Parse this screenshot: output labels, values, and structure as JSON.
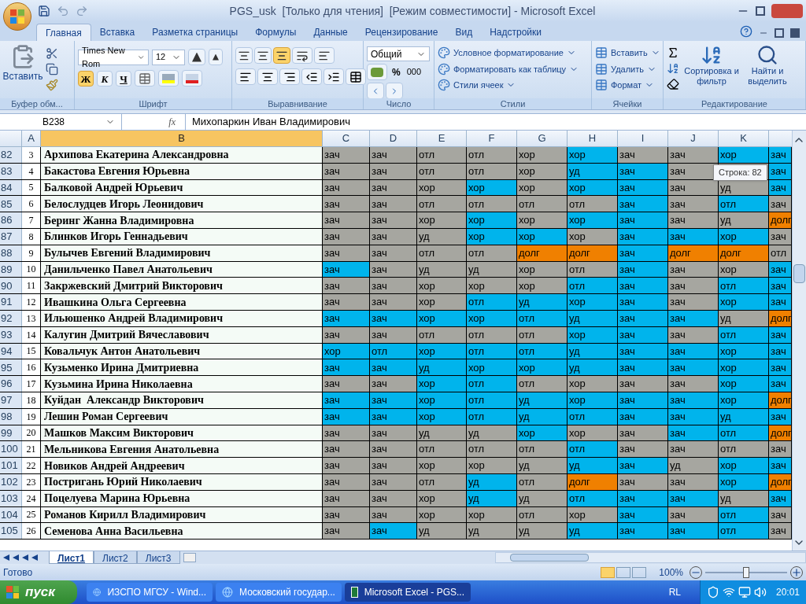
{
  "window": {
    "title": "PGS_usk  [Только для чтения]  [Режим совместимости] - Microsoft Excel"
  },
  "ribbon_tabs": [
    {
      "label": "Главная",
      "selected": true
    },
    {
      "label": "Вставка",
      "selected": false
    },
    {
      "label": "Разметка страницы",
      "selected": false
    },
    {
      "label": "Формулы",
      "selected": false
    },
    {
      "label": "Данные",
      "selected": false
    },
    {
      "label": "Рецензирование",
      "selected": false
    },
    {
      "label": "Вид",
      "selected": false
    },
    {
      "label": "Надстройки",
      "selected": false
    }
  ],
  "ribbon": {
    "clipboard": {
      "label": "Буфер обм...",
      "paste": "Вставить"
    },
    "font": {
      "label": "Шрифт",
      "font_name": "Times New Rom",
      "font_size": "12",
      "styles": [
        {
          "text": "Ж",
          "selected": true
        },
        {
          "text": "К",
          "selected": false
        },
        {
          "text": "Ч",
          "selected": false
        }
      ]
    },
    "alignment": {
      "label": "Выравнивание",
      "vertical": [
        {
          "selected": false
        },
        {
          "selected": false
        },
        {
          "selected": true
        }
      ]
    },
    "number": {
      "label": "Число",
      "format": "Общий",
      "percent": "%",
      "thousands": "000"
    },
    "styles": {
      "label": "Стили",
      "items": [
        "Условное форматирование",
        "Форматировать как таблицу",
        "Стили ячеек"
      ]
    },
    "cells": {
      "label": "Ячейки",
      "items": [
        "Вставить",
        "Удалить",
        "Формат"
      ]
    },
    "editing": {
      "label": "Редактирование",
      "sort": "Сортировка и фильтр",
      "find": "Найти и выделить"
    }
  },
  "formula_bar": {
    "name_box": "B238",
    "fx": "fx",
    "value": "Михопаркин Иван Владимирович"
  },
  "columns": [
    {
      "label": "A",
      "selected": false
    },
    {
      "label": "B",
      "selected": true
    },
    {
      "label": "C",
      "selected": false
    },
    {
      "label": "D",
      "selected": false
    },
    {
      "label": "E",
      "selected": false
    },
    {
      "label": "F",
      "selected": false
    },
    {
      "label": "G",
      "selected": false
    },
    {
      "label": "H",
      "selected": false
    },
    {
      "label": "I",
      "selected": false
    },
    {
      "label": "J",
      "selected": false
    },
    {
      "label": "K",
      "selected": false
    }
  ],
  "rows": [
    {
      "row": "82",
      "num": "3",
      "name": "Архипова Екатерина Александровна",
      "cells": [
        {
          "text": "зач",
          "color": "#a6a6a0"
        },
        {
          "text": "зач",
          "color": "#a6a6a0"
        },
        {
          "text": "отл",
          "color": "#a6a6a0"
        },
        {
          "text": "отл",
          "color": "#a6a6a0"
        },
        {
          "text": "хор",
          "color": "#a6a6a0"
        },
        {
          "text": "хор",
          "color": "#00b4ec"
        },
        {
          "text": "зач",
          "color": "#a6a6a0"
        },
        {
          "text": "зач",
          "color": "#a6a6a0"
        },
        {
          "text": "хор",
          "color": "#00b4ec"
        },
        {
          "text": "зач",
          "color": "#00b4ec"
        }
      ]
    },
    {
      "row": "83",
      "num": "4",
      "name": "Бакастова Евгения Юрьевна",
      "cells": [
        {
          "text": "зач",
          "color": "#a6a6a0"
        },
        {
          "text": "зач",
          "color": "#a6a6a0"
        },
        {
          "text": "отл",
          "color": "#a6a6a0"
        },
        {
          "text": "отл",
          "color": "#a6a6a0"
        },
        {
          "text": "хор",
          "color": "#a6a6a0"
        },
        {
          "text": "уд",
          "color": "#00b4ec"
        },
        {
          "text": "зач",
          "color": "#00b4ec"
        },
        {
          "text": "зач",
          "color": "#a6a6a0"
        },
        {
          "color": "#a6a6a0"
        },
        {
          "text": "зач",
          "color": "#00b4ec"
        }
      ]
    },
    {
      "row": "84",
      "num": "5",
      "name": "Балковой Андрей Юрьевич",
      "cells": [
        {
          "text": "зач",
          "color": "#a6a6a0"
        },
        {
          "text": "зач",
          "color": "#a6a6a0"
        },
        {
          "text": "хор",
          "color": "#a6a6a0"
        },
        {
          "text": "хор",
          "color": "#00b4ec"
        },
        {
          "text": "хор",
          "color": "#a6a6a0"
        },
        {
          "text": "хор",
          "color": "#00b4ec"
        },
        {
          "text": "зач",
          "color": "#00b4ec"
        },
        {
          "text": "зач",
          "color": "#a6a6a0"
        },
        {
          "text": "уд",
          "color": "#a6a6a0"
        },
        {
          "text": "зач",
          "color": "#00b4ec"
        }
      ]
    },
    {
      "row": "85",
      "num": "6",
      "name": "Белослудцев Игорь Леонидович",
      "cells": [
        {
          "text": "зач",
          "color": "#a6a6a0"
        },
        {
          "text": "зач",
          "color": "#a6a6a0"
        },
        {
          "text": "отл",
          "color": "#a6a6a0"
        },
        {
          "text": "отл",
          "color": "#a6a6a0"
        },
        {
          "text": "отл",
          "color": "#a6a6a0"
        },
        {
          "text": "отл",
          "color": "#a6a6a0"
        },
        {
          "text": "зач",
          "color": "#00b4ec"
        },
        {
          "text": "зач",
          "color": "#a6a6a0"
        },
        {
          "text": "отл",
          "color": "#00b4ec"
        },
        {
          "text": "зач",
          "color": "#a6a6a0"
        }
      ]
    },
    {
      "row": "86",
      "num": "7",
      "name": "Беринг Жанна Владимировна",
      "cells": [
        {
          "text": "зач",
          "color": "#a6a6a0"
        },
        {
          "text": "зач",
          "color": "#a6a6a0"
        },
        {
          "text": "хор",
          "color": "#a6a6a0"
        },
        {
          "text": "хор",
          "color": "#00b4ec"
        },
        {
          "text": "хор",
          "color": "#a6a6a0"
        },
        {
          "text": "хор",
          "color": "#00b4ec"
        },
        {
          "text": "зач",
          "color": "#00b4ec"
        },
        {
          "text": "зач",
          "color": "#a6a6a0"
        },
        {
          "text": "уд",
          "color": "#a6a6a0"
        },
        {
          "text": "долг",
          "color": "#f08000"
        }
      ]
    },
    {
      "row": "87",
      "num": "8",
      "name": "Блинков Игорь Геннадьевич",
      "cells": [
        {
          "text": "зач",
          "color": "#a6a6a0"
        },
        {
          "text": "зач",
          "color": "#a6a6a0"
        },
        {
          "text": "уд",
          "color": "#a6a6a0"
        },
        {
          "text": "хор",
          "color": "#00b4ec"
        },
        {
          "text": "хор",
          "color": "#00b4ec"
        },
        {
          "text": "хор",
          "color": "#a6a6a0"
        },
        {
          "text": "зач",
          "color": "#00b4ec"
        },
        {
          "text": "зач",
          "color": "#00b4ec"
        },
        {
          "text": "хор",
          "color": "#00b4ec"
        },
        {
          "text": "зач",
          "color": "#a6a6a0"
        }
      ]
    },
    {
      "row": "88",
      "num": "9",
      "name": "Булычев Евгений Владимирович",
      "cells": [
        {
          "text": "зач",
          "color": "#a6a6a0"
        },
        {
          "text": "зач",
          "color": "#a6a6a0"
        },
        {
          "text": "отл",
          "color": "#a6a6a0"
        },
        {
          "text": "отл",
          "color": "#a6a6a0"
        },
        {
          "text": "долг",
          "color": "#f08000"
        },
        {
          "text": "долг",
          "color": "#f08000"
        },
        {
          "text": "зач",
          "color": "#00b4ec"
        },
        {
          "text": "долг",
          "color": "#f08000"
        },
        {
          "text": "долг",
          "color": "#f08000"
        },
        {
          "text": "отл",
          "color": "#a6a6a0"
        }
      ]
    },
    {
      "row": "89",
      "num": "10",
      "name": "Данильченко Павел Анатольевич",
      "cells": [
        {
          "text": "зач",
          "color": "#00b4ec"
        },
        {
          "text": "зач",
          "color": "#a6a6a0"
        },
        {
          "text": "уд",
          "color": "#a6a6a0"
        },
        {
          "text": "уд",
          "color": "#a6a6a0"
        },
        {
          "text": "хор",
          "color": "#a6a6a0"
        },
        {
          "text": "отл",
          "color": "#a6a6a0"
        },
        {
          "text": "зач",
          "color": "#00b4ec"
        },
        {
          "text": "зач",
          "color": "#a6a6a0"
        },
        {
          "text": "хор",
          "color": "#a6a6a0"
        },
        {
          "text": "зач",
          "color": "#00b4ec"
        }
      ]
    },
    {
      "row": "90",
      "num": "11",
      "name": "Закржевский Дмитрий Викторович",
      "cells": [
        {
          "text": "зач",
          "color": "#a6a6a0"
        },
        {
          "text": "зач",
          "color": "#a6a6a0"
        },
        {
          "text": "хор",
          "color": "#a6a6a0"
        },
        {
          "text": "хор",
          "color": "#a6a6a0"
        },
        {
          "text": "хор",
          "color": "#a6a6a0"
        },
        {
          "text": "отл",
          "color": "#00b4ec"
        },
        {
          "text": "зач",
          "color": "#00b4ec"
        },
        {
          "text": "зач",
          "color": "#a6a6a0"
        },
        {
          "text": "отл",
          "color": "#00b4ec"
        },
        {
          "text": "зач",
          "color": "#00b4ec"
        }
      ]
    },
    {
      "row": "91",
      "num": "12",
      "name": "Ивашкина Ольга Сергеевна",
      "cells": [
        {
          "text": "зач",
          "color": "#a6a6a0"
        },
        {
          "text": "зач",
          "color": "#a6a6a0"
        },
        {
          "text": "хор",
          "color": "#a6a6a0"
        },
        {
          "text": "отл",
          "color": "#00b4ec"
        },
        {
          "text": "уд",
          "color": "#00b4ec"
        },
        {
          "text": "хор",
          "color": "#00b4ec"
        },
        {
          "text": "зач",
          "color": "#00b4ec"
        },
        {
          "text": "зач",
          "color": "#a6a6a0"
        },
        {
          "text": "хор",
          "color": "#00b4ec"
        },
        {
          "text": "зач",
          "color": "#00b4ec"
        }
      ]
    },
    {
      "row": "92",
      "num": "13",
      "name": "Ильюшенко Андрей Владимирович",
      "cells": [
        {
          "text": "зач",
          "color": "#00b4ec"
        },
        {
          "text": "зач",
          "color": "#00b4ec"
        },
        {
          "text": "хор",
          "color": "#00b4ec"
        },
        {
          "text": "хор",
          "color": "#00b4ec"
        },
        {
          "text": "отл",
          "color": "#00b4ec"
        },
        {
          "text": "уд",
          "color": "#00b4ec"
        },
        {
          "text": "зач",
          "color": "#00b4ec"
        },
        {
          "text": "зач",
          "color": "#00b4ec"
        },
        {
          "text": "уд",
          "color": "#a6a6a0"
        },
        {
          "text": "долг",
          "color": "#f08000"
        }
      ]
    },
    {
      "row": "93",
      "num": "14",
      "name": "Калугин Дмитрий Вячеславович",
      "cells": [
        {
          "text": "зач",
          "color": "#a6a6a0"
        },
        {
          "text": "зач",
          "color": "#a6a6a0"
        },
        {
          "text": "отл",
          "color": "#a6a6a0"
        },
        {
          "text": "отл",
          "color": "#a6a6a0"
        },
        {
          "text": "отл",
          "color": "#a6a6a0"
        },
        {
          "text": "хор",
          "color": "#00b4ec"
        },
        {
          "text": "зач",
          "color": "#00b4ec"
        },
        {
          "text": "зач",
          "color": "#a6a6a0"
        },
        {
          "text": "отл",
          "color": "#00b4ec"
        },
        {
          "text": "зач",
          "color": "#00b4ec"
        }
      ]
    },
    {
      "row": "94",
      "num": "15",
      "name": "Ковальчук Антон Анатольевич",
      "cells": [
        {
          "text": "хор",
          "color": "#00b4ec"
        },
        {
          "text": "отл",
          "color": "#00b4ec"
        },
        {
          "text": "хор",
          "color": "#00b4ec"
        },
        {
          "text": "отл",
          "color": "#00b4ec"
        },
        {
          "text": "отл",
          "color": "#00b4ec"
        },
        {
          "text": "уд",
          "color": "#00b4ec"
        },
        {
          "text": "зач",
          "color": "#00b4ec"
        },
        {
          "text": "зач",
          "color": "#00b4ec"
        },
        {
          "text": "хор",
          "color": "#00b4ec"
        },
        {
          "text": "зач",
          "color": "#00b4ec"
        }
      ]
    },
    {
      "row": "95",
      "num": "16",
      "name": "Кузьменко Ирина Дмитриевна",
      "cells": [
        {
          "text": "зач",
          "color": "#00b4ec"
        },
        {
          "text": "зач",
          "color": "#00b4ec"
        },
        {
          "text": "уд",
          "color": "#00b4ec"
        },
        {
          "text": "хор",
          "color": "#00b4ec"
        },
        {
          "text": "хор",
          "color": "#00b4ec"
        },
        {
          "text": "уд",
          "color": "#00b4ec"
        },
        {
          "text": "зач",
          "color": "#00b4ec"
        },
        {
          "text": "зач",
          "color": "#00b4ec"
        },
        {
          "text": "хор",
          "color": "#00b4ec"
        },
        {
          "text": "зач",
          "color": "#00b4ec"
        }
      ]
    },
    {
      "row": "96",
      "num": "17",
      "name": "Кузьмина Ирина Николаевна",
      "cells": [
        {
          "text": "зач",
          "color": "#a6a6a0"
        },
        {
          "text": "зач",
          "color": "#a6a6a0"
        },
        {
          "text": "хор",
          "color": "#00b4ec"
        },
        {
          "text": "отл",
          "color": "#00b4ec"
        },
        {
          "text": "отл",
          "color": "#a6a6a0"
        },
        {
          "text": "хор",
          "color": "#a6a6a0"
        },
        {
          "text": "зач",
          "color": "#a6a6a0"
        },
        {
          "text": "зач",
          "color": "#a6a6a0"
        },
        {
          "text": "хор",
          "color": "#00b4ec"
        },
        {
          "text": "зач",
          "color": "#00b4ec"
        }
      ]
    },
    {
      "row": "97",
      "num": "18",
      "name": "Куйдан  Александр Викторович",
      "cells": [
        {
          "text": "зач",
          "color": "#00b4ec"
        },
        {
          "text": "зач",
          "color": "#00b4ec"
        },
        {
          "text": "хор",
          "color": "#00b4ec"
        },
        {
          "text": "отл",
          "color": "#00b4ec"
        },
        {
          "text": "уд",
          "color": "#00b4ec"
        },
        {
          "text": "хор",
          "color": "#00b4ec"
        },
        {
          "text": "зач",
          "color": "#00b4ec"
        },
        {
          "text": "зач",
          "color": "#00b4ec"
        },
        {
          "text": "хор",
          "color": "#00b4ec"
        },
        {
          "text": "долг",
          "color": "#f08000"
        }
      ]
    },
    {
      "row": "98",
      "num": "19",
      "name": "Лешин Роман Сергеевич",
      "cells": [
        {
          "text": "зач",
          "color": "#00b4ec"
        },
        {
          "text": "зач",
          "color": "#00b4ec"
        },
        {
          "text": "хор",
          "color": "#00b4ec"
        },
        {
          "text": "отл",
          "color": "#00b4ec"
        },
        {
          "text": "уд",
          "color": "#00b4ec"
        },
        {
          "text": "отл",
          "color": "#00b4ec"
        },
        {
          "text": "зач",
          "color": "#00b4ec"
        },
        {
          "text": "зач",
          "color": "#00b4ec"
        },
        {
          "text": "уд",
          "color": "#00b4ec"
        },
        {
          "text": "зач",
          "color": "#00b4ec"
        }
      ]
    },
    {
      "row": "99",
      "num": "20",
      "name": "Машков Максим Викторович",
      "cells": [
        {
          "text": "зач",
          "color": "#a6a6a0"
        },
        {
          "text": "зач",
          "color": "#a6a6a0"
        },
        {
          "text": "уд",
          "color": "#a6a6a0"
        },
        {
          "text": "уд",
          "color": "#a6a6a0"
        },
        {
          "text": "хор",
          "color": "#00b4ec"
        },
        {
          "text": "хор",
          "color": "#a6a6a0"
        },
        {
          "text": "зач",
          "color": "#a6a6a0"
        },
        {
          "text": "зач",
          "color": "#00b4ec"
        },
        {
          "text": "отл",
          "color": "#00b4ec"
        },
        {
          "text": "долг",
          "color": "#f08000"
        }
      ]
    },
    {
      "row": "100",
      "num": "21",
      "name": "Мельникова Евгения Анатольевна",
      "cells": [
        {
          "text": "зач",
          "color": "#a6a6a0"
        },
        {
          "text": "зач",
          "color": "#a6a6a0"
        },
        {
          "text": "отл",
          "color": "#a6a6a0"
        },
        {
          "text": "отл",
          "color": "#a6a6a0"
        },
        {
          "text": "отл",
          "color": "#a6a6a0"
        },
        {
          "text": "отл",
          "color": "#00b4ec"
        },
        {
          "text": "зач",
          "color": "#a6a6a0"
        },
        {
          "text": "зач",
          "color": "#a6a6a0"
        },
        {
          "text": "отл",
          "color": "#a6a6a0"
        },
        {
          "text": "зач",
          "color": "#a6a6a0"
        }
      ]
    },
    {
      "row": "101",
      "num": "22",
      "name": "Новиков Андрей Андреевич",
      "cells": [
        {
          "text": "зач",
          "color": "#a6a6a0"
        },
        {
          "text": "зач",
          "color": "#a6a6a0"
        },
        {
          "text": "хор",
          "color": "#a6a6a0"
        },
        {
          "text": "хор",
          "color": "#a6a6a0"
        },
        {
          "text": "уд",
          "color": "#a6a6a0"
        },
        {
          "text": "уд",
          "color": "#00b4ec"
        },
        {
          "text": "зач",
          "color": "#00b4ec"
        },
        {
          "text": "уд",
          "color": "#a6a6a0"
        },
        {
          "text": "хор",
          "color": "#00b4ec"
        },
        {
          "text": "зач",
          "color": "#00b4ec"
        }
      ]
    },
    {
      "row": "102",
      "num": "23",
      "name": "Постригань Юрий Николаевич",
      "cells": [
        {
          "text": "зач",
          "color": "#a6a6a0"
        },
        {
          "text": "зач",
          "color": "#a6a6a0"
        },
        {
          "text": "отл",
          "color": "#a6a6a0"
        },
        {
          "text": "уд",
          "color": "#00b4ec"
        },
        {
          "text": "отл",
          "color": "#a6a6a0"
        },
        {
          "text": "долг",
          "color": "#f08000"
        },
        {
          "text": "зач",
          "color": "#a6a6a0"
        },
        {
          "text": "зач",
          "color": "#a6a6a0"
        },
        {
          "text": "хор",
          "color": "#00b4ec"
        },
        {
          "text": "долг",
          "color": "#f08000"
        }
      ]
    },
    {
      "row": "103",
      "num": "24",
      "name": "Поцелуева Марина Юрьевна",
      "cells": [
        {
          "text": "зач",
          "color": "#a6a6a0"
        },
        {
          "text": "зач",
          "color": "#a6a6a0"
        },
        {
          "text": "хор",
          "color": "#a6a6a0"
        },
        {
          "text": "уд",
          "color": "#00b4ec"
        },
        {
          "text": "уд",
          "color": "#a6a6a0"
        },
        {
          "text": "отл",
          "color": "#00b4ec"
        },
        {
          "text": "зач",
          "color": "#00b4ec"
        },
        {
          "text": "зач",
          "color": "#00b4ec"
        },
        {
          "text": "уд",
          "color": "#a6a6a0"
        },
        {
          "text": "зач",
          "color": "#00b4ec"
        }
      ]
    },
    {
      "row": "104",
      "num": "25",
      "name": "Романов Кирилл Владимирович",
      "cells": [
        {
          "text": "зач",
          "color": "#a6a6a0"
        },
        {
          "text": "зач",
          "color": "#a6a6a0"
        },
        {
          "text": "хор",
          "color": "#a6a6a0"
        },
        {
          "text": "хор",
          "color": "#a6a6a0"
        },
        {
          "text": "отл",
          "color": "#a6a6a0"
        },
        {
          "text": "хор",
          "color": "#a6a6a0"
        },
        {
          "text": "зач",
          "color": "#00b4ec"
        },
        {
          "text": "зач",
          "color": "#a6a6a0"
        },
        {
          "text": "отл",
          "color": "#00b4ec"
        },
        {
          "text": "зач",
          "color": "#a6a6a0"
        }
      ]
    },
    {
      "row": "105",
      "num": "26",
      "name": "Семенова Анна Васильевна",
      "cells": [
        {
          "text": "зач",
          "color": "#a6a6a0"
        },
        {
          "text": "зач",
          "color": "#00b4ec"
        },
        {
          "text": "уд",
          "color": "#a6a6a0"
        },
        {
          "text": "уд",
          "color": "#a6a6a0"
        },
        {
          "text": "уд",
          "color": "#a6a6a0"
        },
        {
          "text": "уд",
          "color": "#00b4ec"
        },
        {
          "text": "зач",
          "color": "#00b4ec"
        },
        {
          "text": "зач",
          "color": "#00b4ec"
        },
        {
          "text": "отл",
          "color": "#00b4ec"
        },
        {
          "text": "зач",
          "color": "#a6a6a0"
        }
      ]
    }
  ],
  "tooltip": "Строка: 82",
  "sheet_tabs": [
    {
      "label": "Лист1",
      "selected": true
    },
    {
      "label": "Лист2",
      "selected": false
    },
    {
      "label": "Лист3",
      "selected": false
    }
  ],
  "status_bar": {
    "text": "Готово",
    "zoom": "100%",
    "zoom_slider": {
      "level": 0.5
    }
  },
  "taskbar": {
    "start": "пуск",
    "tasks": [
      {
        "label": "ИЗСПО МГСУ - Wind...",
        "kind": "browser",
        "selected": false
      },
      {
        "label": "Московский государ...",
        "kind": "browser",
        "selected": false
      },
      {
        "label": "Microsoft Excel - PGS...",
        "kind": "excel",
        "selected": true
      }
    ],
    "language": "RL",
    "clock": "20:01"
  }
}
